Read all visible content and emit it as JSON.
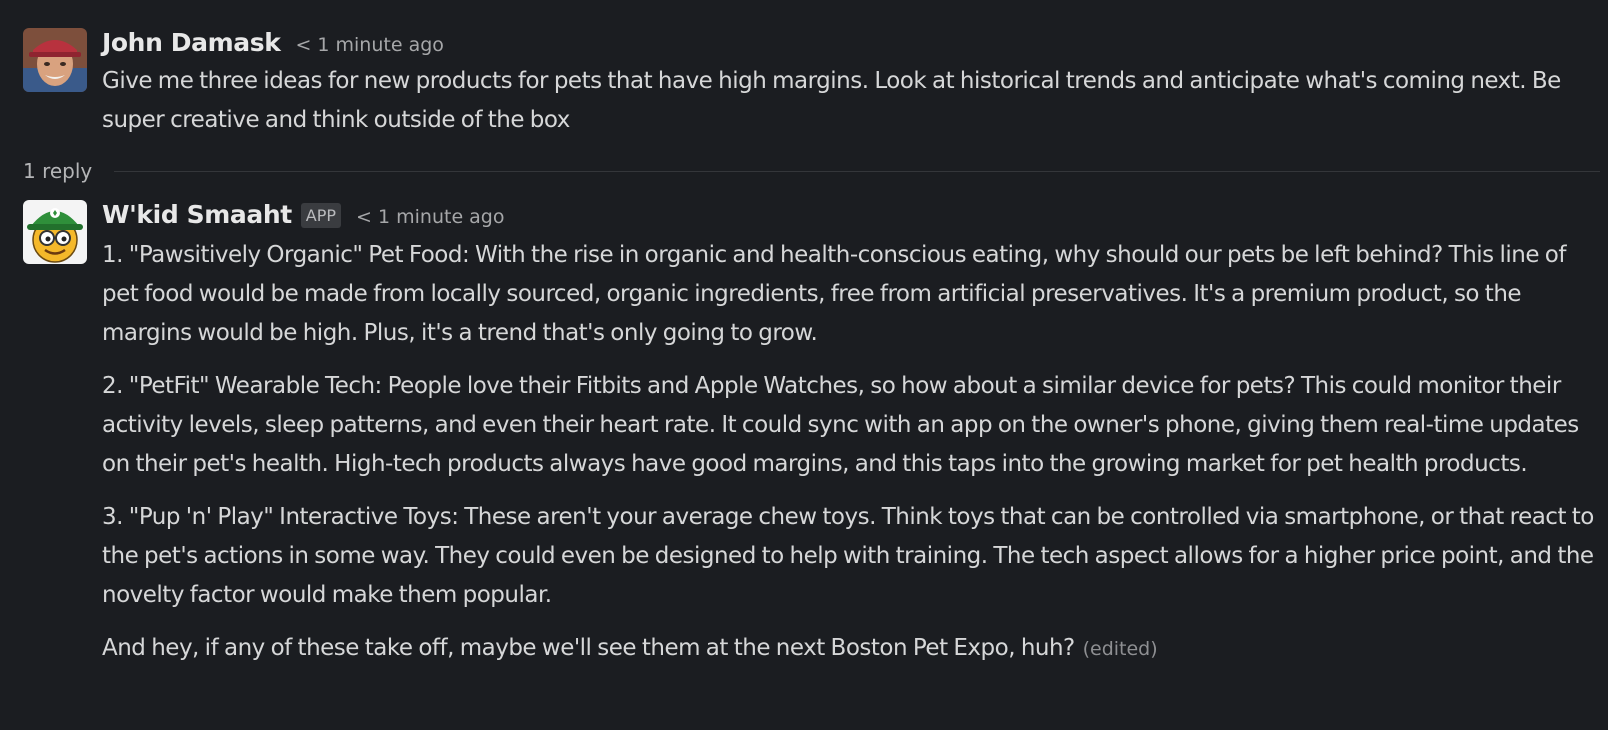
{
  "messages": [
    {
      "author": "John Damask",
      "timestamp": "< 1 minute ago",
      "paragraphs": [
        "Give me three ideas for new products for pets that have high margins. Look at historical trends and anticipate what's coming next. Be super creative and think outside of the box"
      ]
    },
    {
      "author": "W'kid Smaaht",
      "badge": "APP",
      "timestamp": "< 1 minute ago",
      "paragraphs": [
        "1. \"Pawsitively Organic\" Pet Food: With the rise in organic and health-conscious eating, why should our pets be left behind? This line of pet food would be made from locally sourced, organic ingredients, free from artificial preservatives. It's a premium product, so the margins would be high. Plus, it's a trend that's only going to grow.",
        "2. \"PetFit\" Wearable Tech: People love their Fitbits and Apple Watches, so how about a similar device for pets? This could monitor their activity levels, sleep patterns, and even their heart rate. It could sync with an app on the owner's phone, giving them real-time updates on their pet's health. High-tech products always have good margins, and this taps into the growing market for pet health products.",
        "3. \"Pup 'n' Play\" Interactive Toys: These aren't your average chew toys. Think toys that can be controlled via smartphone, or that react to the pet's actions in some way. They could even be designed to help with training. The tech aspect allows for a higher price point, and the novelty factor would make them popular.",
        "And hey, if any of these take off, maybe we'll see them at the next Boston Pet Expo, huh?"
      ],
      "edited_label": "(edited)"
    }
  ],
  "thread": {
    "reply_count": "1 reply"
  },
  "colors": {
    "background": "#1b1d21",
    "text": "#d6d7d8",
    "muted": "#a6a7a9",
    "badge_bg": "#3a3c40"
  },
  "icons": {
    "user_avatar": "person-photo-avatar",
    "bot_avatar": "smiley-face-with-green-cap-avatar"
  }
}
